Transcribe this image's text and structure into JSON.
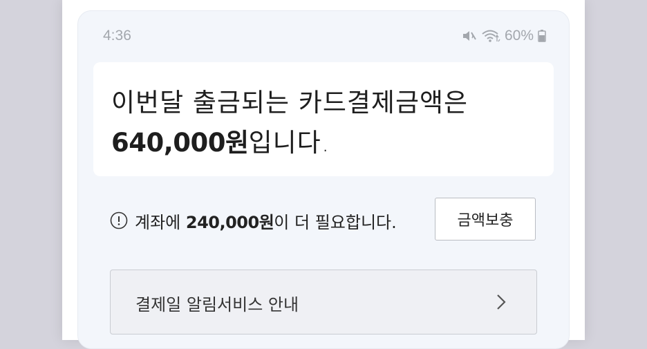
{
  "status_bar": {
    "time": "4:36",
    "battery": "60%"
  },
  "amount_card": {
    "line1": "이번달 출금되는 카드결제금액은",
    "amount": "640,000원",
    "tail": "입니다."
  },
  "notice": {
    "prefix": "계좌에 ",
    "amount": "240,000원",
    "suffix": "이 더 필요합니다."
  },
  "buttons": {
    "topup_label": "금액보충"
  },
  "alarm_service": {
    "label": "결제일 알림서비스 안내"
  },
  "colors": {
    "screen_bg": "#f3f6fb",
    "card_bg": "#ffffff",
    "status_gray": "#a3a7ad",
    "text_dark": "#1e1e1e"
  }
}
